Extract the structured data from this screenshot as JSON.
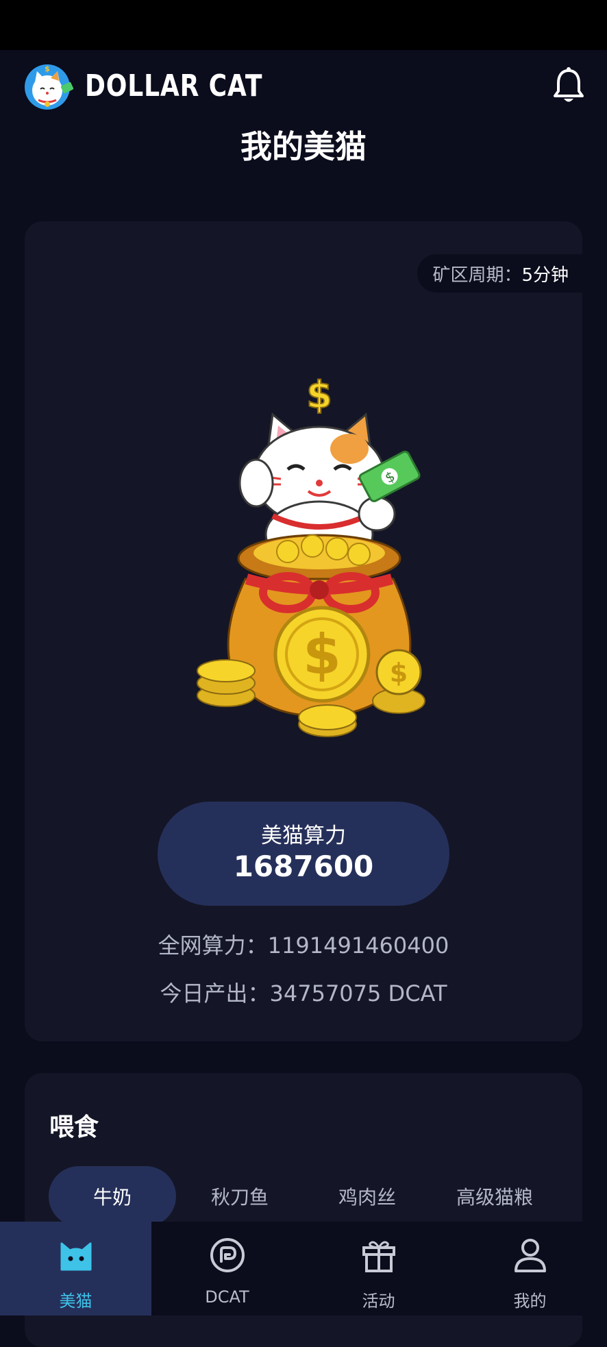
{
  "header": {
    "brand": "DOLLAR CAT",
    "page_title": "我的美猫"
  },
  "mining": {
    "cycle_label": "矿区周期：",
    "cycle_value": "5分钟",
    "power_label": "美猫算力",
    "power_value": "1687600",
    "network_power": "全网算力：1191491460400",
    "today_output": "今日产出：34757075 DCAT"
  },
  "feed": {
    "title": "喂食",
    "tabs": [
      {
        "label": "牛奶",
        "active": true
      },
      {
        "label": "秋刀鱼",
        "active": false
      },
      {
        "label": "鸡肉丝",
        "active": false
      },
      {
        "label": "高级猫粮",
        "active": false
      }
    ]
  },
  "nav": {
    "items": [
      {
        "label": "美猫",
        "icon": "cat-icon",
        "active": true
      },
      {
        "label": "DCAT",
        "icon": "dcat-coin-icon",
        "active": false
      },
      {
        "label": "活动",
        "icon": "gift-icon",
        "active": false
      },
      {
        "label": "我的",
        "icon": "user-icon",
        "active": false
      }
    ]
  },
  "colors": {
    "background": "#0b0c1c",
    "card": "#141627",
    "pill": "#25305a",
    "accent": "#3ec2e8"
  }
}
